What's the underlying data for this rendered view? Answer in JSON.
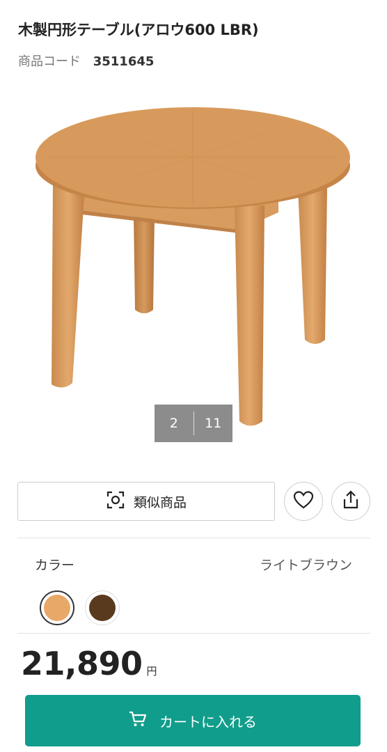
{
  "product": {
    "title": "木製円形テーブル(アロウ600 LBR)",
    "code_label": "商品コード",
    "code_value": "3511645"
  },
  "gallery": {
    "current": "2",
    "total": "11"
  },
  "actions": {
    "similar_label": "類似商品",
    "similar_icon": "camera-scan-icon",
    "favorite_icon": "heart-icon",
    "share_icon": "share-icon"
  },
  "color": {
    "label": "カラー",
    "selected_name": "ライトブラウン",
    "swatches": [
      {
        "hex": "#e8a868",
        "selected": true
      },
      {
        "hex": "#5a3a1e",
        "selected": false
      }
    ]
  },
  "price": {
    "amount": "21,890",
    "unit": "円"
  },
  "cart": {
    "label": "カートに入れる",
    "icon": "cart-icon",
    "color": "#119d8b"
  }
}
